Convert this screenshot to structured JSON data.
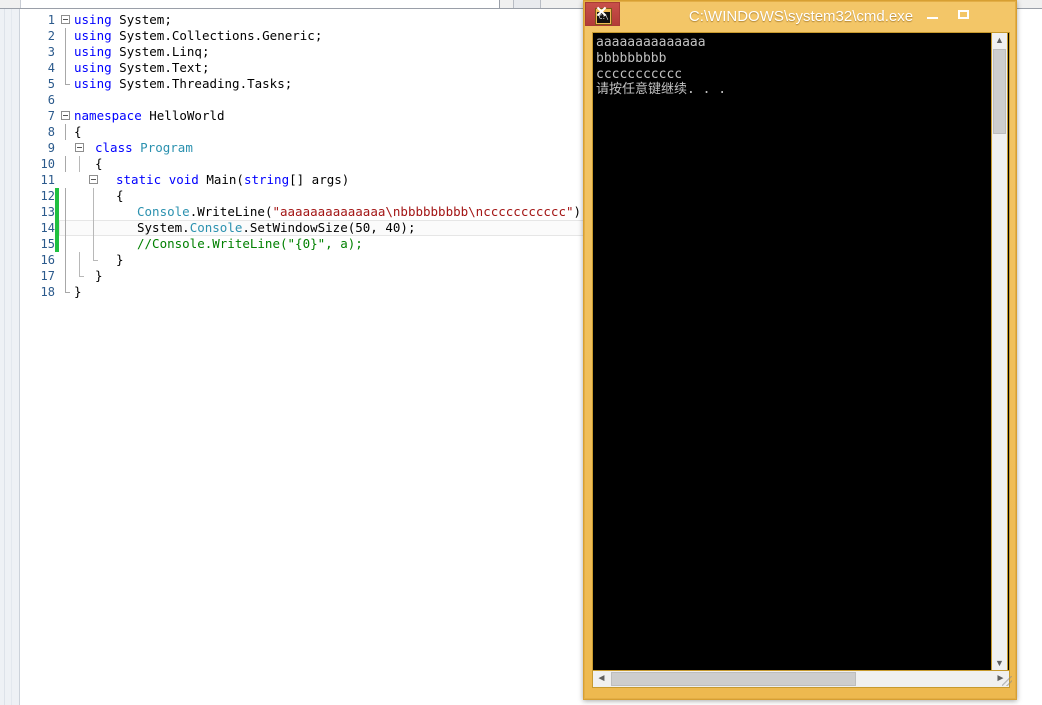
{
  "editor": {
    "name": "code-editor",
    "language": "C#",
    "lines": [
      {
        "num": "1",
        "fold": "open",
        "indent": 0,
        "tokens": [
          {
            "t": "using",
            "c": "kw"
          },
          {
            "t": " System;",
            "c": "pln"
          }
        ]
      },
      {
        "num": "2",
        "fold": "bar",
        "indent": 0,
        "tokens": [
          {
            "t": "using",
            "c": "kw"
          },
          {
            "t": " System.Collections.Generic;",
            "c": "pln"
          }
        ]
      },
      {
        "num": "3",
        "fold": "bar",
        "indent": 0,
        "tokens": [
          {
            "t": "using",
            "c": "kw"
          },
          {
            "t": " System.Linq;",
            "c": "pln"
          }
        ]
      },
      {
        "num": "4",
        "fold": "bar",
        "indent": 0,
        "tokens": [
          {
            "t": "using",
            "c": "kw"
          },
          {
            "t": " System.Text;",
            "c": "pln"
          }
        ]
      },
      {
        "num": "5",
        "fold": "barend",
        "indent": 0,
        "tokens": [
          {
            "t": "using",
            "c": "kw"
          },
          {
            "t": " System.Threading.Tasks;",
            "c": "pln"
          }
        ]
      },
      {
        "num": "6",
        "fold": "none",
        "indent": 0,
        "tokens": []
      },
      {
        "num": "7",
        "fold": "open",
        "indent": 0,
        "tokens": [
          {
            "t": "namespace",
            "c": "kw"
          },
          {
            "t": " HelloWorld",
            "c": "pln"
          }
        ]
      },
      {
        "num": "8",
        "fold": "bar",
        "indent": 0,
        "tokens": [
          {
            "t": "{",
            "c": "pln"
          }
        ]
      },
      {
        "num": "9",
        "fold": "open2",
        "indent": 1,
        "tokens": [
          {
            "t": "class",
            "c": "kw"
          },
          {
            "t": " ",
            "c": "pln"
          },
          {
            "t": "Program",
            "c": "typ"
          }
        ]
      },
      {
        "num": "10",
        "fold": "bar2",
        "indent": 1,
        "tokens": [
          {
            "t": "{",
            "c": "pln"
          }
        ]
      },
      {
        "num": "11",
        "fold": "open3",
        "indent": 2,
        "tokens": [
          {
            "t": "static",
            "c": "kw"
          },
          {
            "t": " ",
            "c": "pln"
          },
          {
            "t": "void",
            "c": "kw"
          },
          {
            "t": " Main(",
            "c": "pln"
          },
          {
            "t": "string",
            "c": "kw"
          },
          {
            "t": "[] args)",
            "c": "pln"
          }
        ]
      },
      {
        "num": "12",
        "fold": "bar3",
        "indent": 2,
        "tokens": [
          {
            "t": "{",
            "c": "pln"
          }
        ]
      },
      {
        "num": "13",
        "fold": "bar3",
        "indent": 3,
        "tokens": [
          {
            "t": "Console",
            "c": "typ"
          },
          {
            "t": ".WriteLine(",
            "c": "pln"
          },
          {
            "t": "\"aaaaaaaaaaaaaa\\nbbbbbbbbb\\nccccccccccc\"",
            "c": "str"
          },
          {
            "t": ");",
            "c": "pln"
          }
        ]
      },
      {
        "num": "14",
        "fold": "bar3",
        "indent": 3,
        "tokens": [
          {
            "t": "System.",
            "c": "pln"
          },
          {
            "t": "Console",
            "c": "typ"
          },
          {
            "t": ".SetWindowSize(50, 40);",
            "c": "pln"
          }
        ]
      },
      {
        "num": "15",
        "fold": "bar3",
        "indent": 3,
        "tokens": [
          {
            "t": "//Console.WriteLine(\"{0}\", a);",
            "c": "cmt"
          }
        ]
      },
      {
        "num": "16",
        "fold": "end3",
        "indent": 2,
        "tokens": [
          {
            "t": "}",
            "c": "pln"
          }
        ]
      },
      {
        "num": "17",
        "fold": "end2",
        "indent": 1,
        "tokens": [
          {
            "t": "}",
            "c": "pln"
          }
        ]
      },
      {
        "num": "18",
        "fold": "end1",
        "indent": 0,
        "tokens": [
          {
            "t": "}",
            "c": "pln"
          }
        ]
      }
    ],
    "current_line": "14",
    "change_bar_lines": [
      "12",
      "13",
      "14",
      "15"
    ],
    "change_bar_color": "#20c040"
  },
  "console_window": {
    "name": "cmd-window",
    "title": "C:\\WINDOWS\\system32\\cmd.exe",
    "icon_label": "C:\\",
    "titlebar_color": "#efbc55",
    "close_button_color": "#b33c38",
    "buttons": {
      "minimize": "minimize",
      "maximize": "maximize",
      "close": "close"
    },
    "output_lines": [
      "aaaaaaaaaaaaaa",
      "bbbbbbbbb",
      "ccccccccccc",
      "请按任意键继续. . ."
    ],
    "text_color": "#c0c0c0",
    "background_color": "#000000",
    "scrollbars": {
      "vertical": {
        "up_glyph": "▲",
        "down_glyph": "▼"
      },
      "horizontal": {
        "left_glyph": "◄",
        "right_glyph": "►"
      }
    }
  }
}
